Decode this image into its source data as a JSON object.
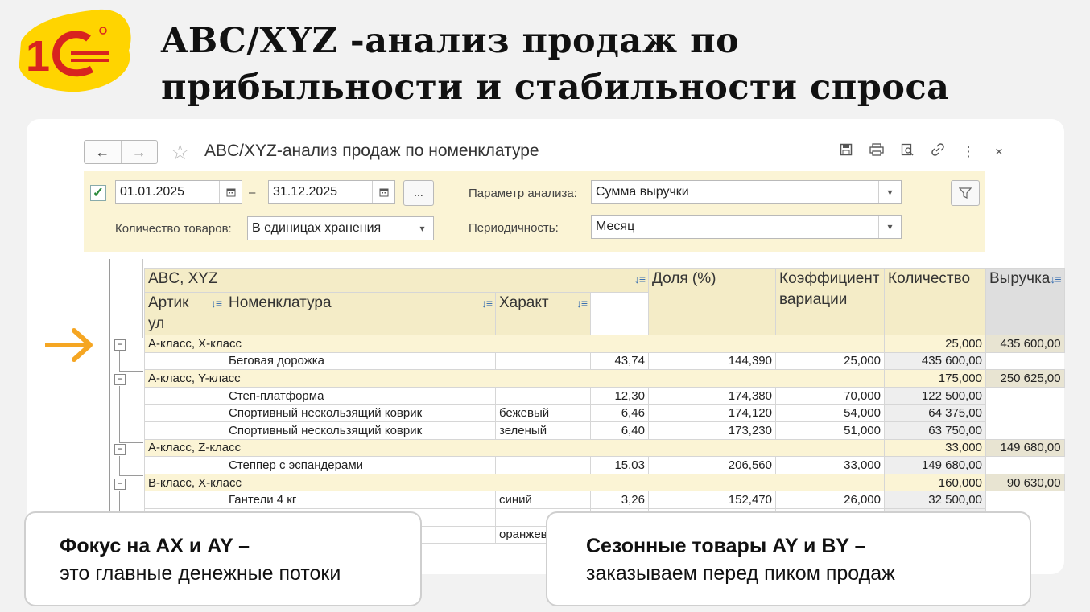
{
  "slide": {
    "title_line1": "ABC/XYZ -анализ продаж по",
    "title_line2": "прибыльности и стабильности спроса"
  },
  "logo": {
    "icon": "1c-logo",
    "text": "1С"
  },
  "window": {
    "title": "ABC/XYZ-анализ продаж по номенклатуре",
    "back": "←",
    "forward": "→",
    "star": "☆",
    "close": "×",
    "more": "⋮",
    "toolbar_icons": [
      "save-icon",
      "print-icon",
      "preview-icon",
      "link-icon",
      "more-icon",
      "close-icon"
    ]
  },
  "params": {
    "period_enabled": true,
    "date_from": "01.01.2025",
    "date_sep": "–",
    "date_to": "31.12.2025",
    "dots": "...",
    "analysis_param_label": "Параметр анализа:",
    "analysis_param_value": "Сумма выручки",
    "qty_label": "Количество товаров:",
    "qty_value": "В единицах хранения",
    "periodicity_label": "Периодичность:",
    "periodicity_value": "Месяц"
  },
  "table": {
    "headers": {
      "abcxyz": "ABC, XYZ",
      "article_1": "Артик",
      "article_2": "ул",
      "item": "Номенклатура",
      "char": "Характ",
      "share": "Доля (%)",
      "coef": "Коэффициент вариации",
      "qty": "Количество",
      "revenue": "Выручка"
    },
    "rows": [
      {
        "type": "group",
        "name": "А-класс, X-класс",
        "qty": "25,000",
        "revenue": "435 600,00"
      },
      {
        "type": "item",
        "article": "",
        "item": "Беговая дорожка",
        "char": "",
        "share": "43,74",
        "coef": "144,390",
        "qty": "25,000",
        "revenue": "435 600,00"
      },
      {
        "type": "group",
        "name": "А-класс, Y-класс",
        "qty": "175,000",
        "revenue": "250 625,00"
      },
      {
        "type": "item",
        "article": "",
        "item": "Степ-платформа",
        "char": "",
        "share": "12,30",
        "coef": "174,380",
        "qty": "70,000",
        "revenue": "122 500,00"
      },
      {
        "type": "item",
        "article": "",
        "item": "Спортивный нескользящий коврик",
        "char": "бежевый",
        "share": "6,46",
        "coef": "174,120",
        "qty": "54,000",
        "revenue": "64 375,00"
      },
      {
        "type": "item",
        "article": "",
        "item": "Спортивный нескользящий коврик",
        "char": "зеленый",
        "share": "6,40",
        "coef": "173,230",
        "qty": "51,000",
        "revenue": "63 750,00"
      },
      {
        "type": "group",
        "name": "А-класс, Z-класс",
        "qty": "33,000",
        "revenue": "149 680,00"
      },
      {
        "type": "item",
        "article": "",
        "item": "Степпер  с эспандерами",
        "char": "",
        "share": "15,03",
        "coef": "206,560",
        "qty": "33,000",
        "revenue": "149 680,00"
      },
      {
        "type": "group",
        "name": "В-класс, X-класс",
        "qty": "160,000",
        "revenue": "90 630,00"
      },
      {
        "type": "item",
        "article": "",
        "item": "Гантели 4 кг",
        "char": "синий",
        "share": "3,26",
        "coef": "152,470",
        "qty": "26,000",
        "revenue": "32 500,00"
      },
      {
        "type": "item",
        "article": "",
        "item": "",
        "char": "",
        "share": "",
        "coef": "",
        "qty": "",
        "revenue": ""
      },
      {
        "type": "item",
        "article": "",
        "item": "",
        "char": "оранжев",
        "share": "",
        "coef": "",
        "qty": "",
        "revenue": ""
      }
    ]
  },
  "callouts": {
    "left_bold": "Фокус на AX и AY –",
    "left_text": "это главные денежные потоки",
    "right_bold": "Сезонные товары AY и BY –",
    "right_text": "заказываем перед пиком продаж"
  },
  "colors": {
    "accent_arrow": "#f5a623",
    "logo_red": "#d8231f",
    "logo_yellow": "#ffd400",
    "params_bg": "#fbf4d5"
  }
}
